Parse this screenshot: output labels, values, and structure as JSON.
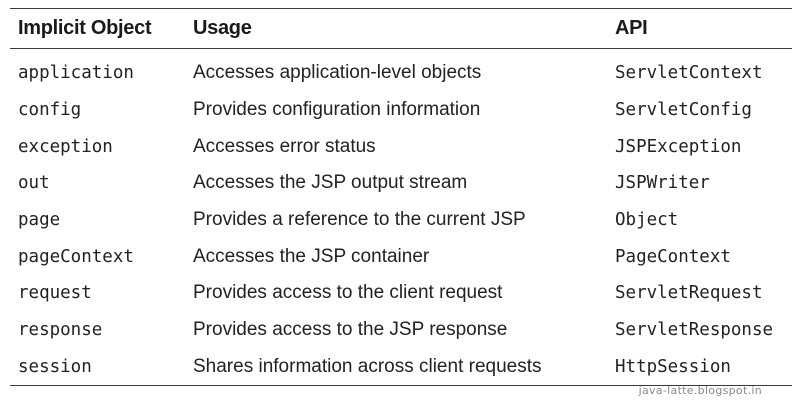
{
  "table": {
    "headers": {
      "object": "Implicit Object",
      "usage": "Usage",
      "api": "API"
    },
    "rows": [
      {
        "object": "application",
        "usage": "Accesses application-level objects",
        "api": "ServletContext"
      },
      {
        "object": "config",
        "usage": "Provides configuration information",
        "api": "ServletConfig"
      },
      {
        "object": "exception",
        "usage": "Accesses error status",
        "api": "JSPException"
      },
      {
        "object": "out",
        "usage": "Accesses the JSP output stream",
        "api": "JSPWriter"
      },
      {
        "object": "page",
        "usage": "Provides a reference to the current JSP",
        "api": "Object"
      },
      {
        "object": "pageContext",
        "usage": "Accesses the JSP container",
        "api": "PageContext"
      },
      {
        "object": "request",
        "usage": "Provides access to the client request",
        "api": "ServletRequest"
      },
      {
        "object": "response",
        "usage": "Provides access to the JSP response",
        "api": "ServletResponse"
      },
      {
        "object": "session",
        "usage": "Shares information across client requests",
        "api": "HttpSession"
      }
    ]
  },
  "watermark": "java-latte.blogspot.in"
}
